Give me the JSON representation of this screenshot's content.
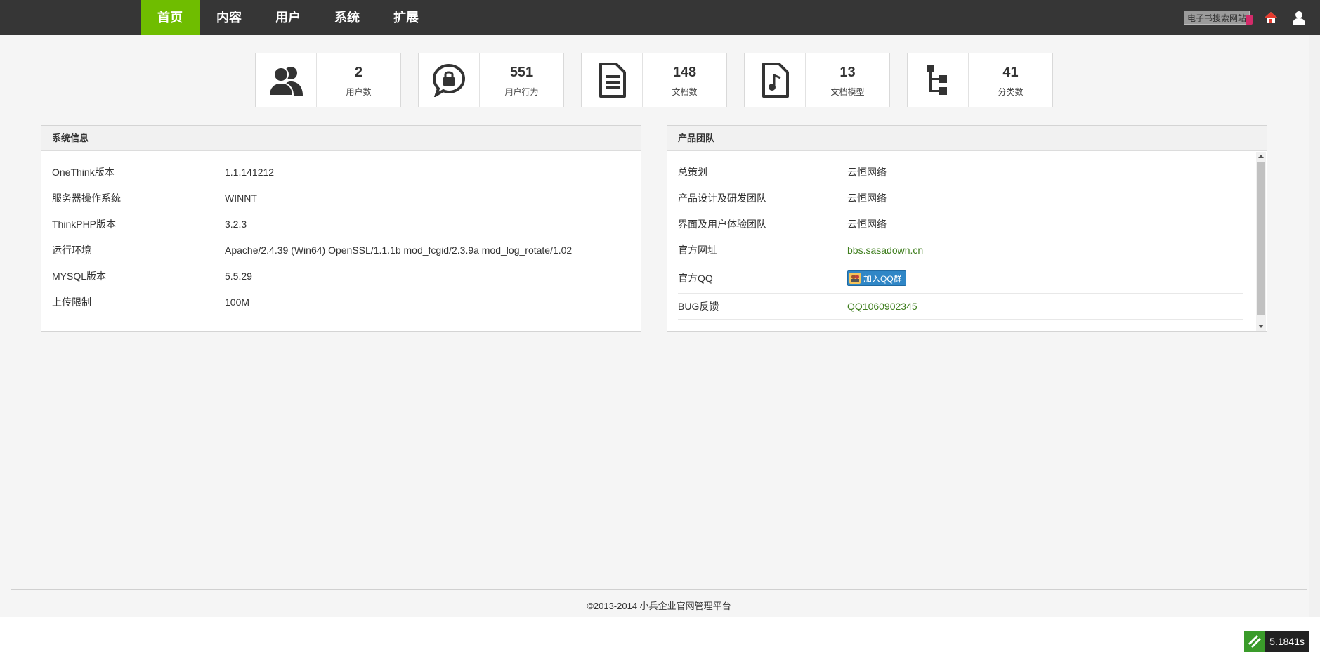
{
  "nav": {
    "items": [
      {
        "label": "首页",
        "active": true
      },
      {
        "label": "内容",
        "active": false
      },
      {
        "label": "用户",
        "active": false
      },
      {
        "label": "系统",
        "active": false
      },
      {
        "label": "扩展",
        "active": false
      }
    ],
    "site_button": "电子书搜索网站",
    "icons": [
      "home-icon",
      "user-icon"
    ]
  },
  "stats": [
    {
      "value": "2",
      "label": "用户数",
      "icon": "users-icon"
    },
    {
      "value": "551",
      "label": "用户行为",
      "icon": "chat-lock-icon"
    },
    {
      "value": "148",
      "label": "文档数",
      "icon": "document-icon"
    },
    {
      "value": "13",
      "label": "文档模型",
      "icon": "file-music-icon"
    },
    {
      "value": "41",
      "label": "分类数",
      "icon": "tree-icon"
    }
  ],
  "system_info": {
    "title": "系统信息",
    "rows": [
      {
        "key": "OneThink版本",
        "value": "1.1.141212"
      },
      {
        "key": "服务器操作系统",
        "value": "WINNT"
      },
      {
        "key": "ThinkPHP版本",
        "value": "3.2.3"
      },
      {
        "key": "运行环境",
        "value": "Apache/2.4.39 (Win64) OpenSSL/1.1.1b mod_fcgid/2.3.9a mod_log_rotate/1.02"
      },
      {
        "key": "MYSQL版本",
        "value": "5.5.29"
      },
      {
        "key": "上传限制",
        "value": "100M"
      }
    ]
  },
  "team": {
    "title": "产品团队",
    "rows": [
      {
        "key": "总策划",
        "value": "云恒网络"
      },
      {
        "key": "产品设计及研发团队",
        "value": "云恒网络"
      },
      {
        "key": "界面及用户体验团队",
        "value": "云恒网络"
      },
      {
        "key": "官方网址",
        "value": "bbs.sasadown.cn"
      },
      {
        "key": "官方QQ",
        "value": "加入QQ群"
      },
      {
        "key": "BUG反馈",
        "value": "QQ1060902345"
      }
    ]
  },
  "footer": {
    "copyright": "©2013-2014 小兵企业官网管理平台",
    "timer": "5.1841s"
  },
  "colors": {
    "nav_bg": "#363636",
    "nav_active": "#6fbd00",
    "link_green": "#3f7e1e"
  }
}
